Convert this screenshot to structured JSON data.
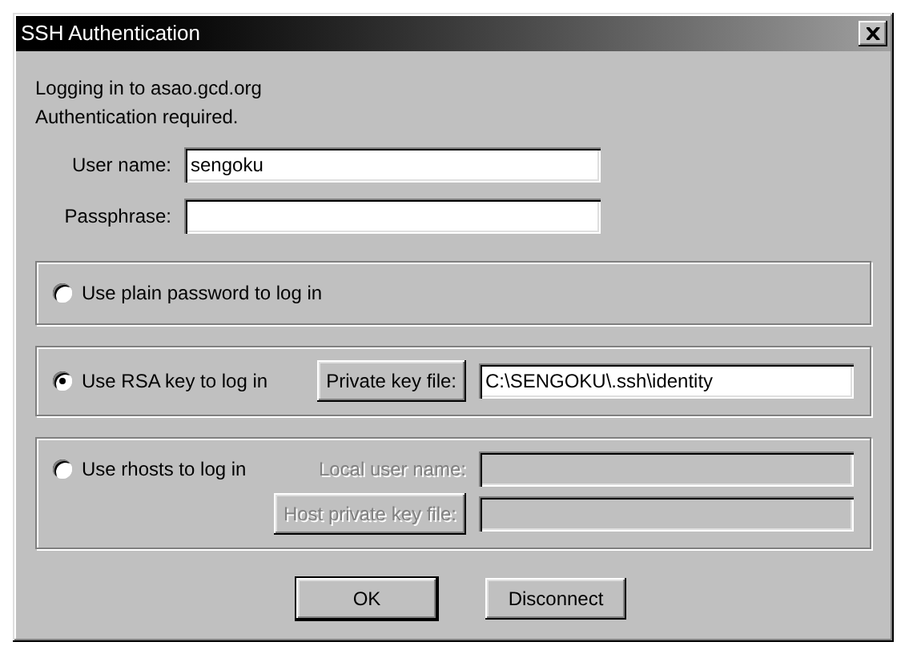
{
  "window": {
    "title": "SSH Authentication"
  },
  "messages": [
    "Logging in to asao.gcd.org",
    "Authentication required."
  ],
  "fields": [
    {
      "label": "User name:",
      "value": "sengoku"
    },
    {
      "label": "Passphrase:"
    }
  ],
  "methods": [
    {
      "label": "Use plain password to log in",
      "selected": false
    },
    {
      "label": "Use RSA key to log in",
      "selected": true,
      "controls": [
        {
          "kind": "file",
          "button": "Private key file:",
          "value": "C:\\SENGOKU\\.ssh\\identity",
          "disabled": false
        }
      ]
    },
    {
      "label": "Use rhosts to log in",
      "selected": false,
      "controls": [
        {
          "kind": "text",
          "label": "Local user name:",
          "disabled": true
        },
        {
          "kind": "file",
          "button": "Host private key file:",
          "disabled": true
        }
      ]
    }
  ],
  "buttons": [
    {
      "label": "OK",
      "default": true
    },
    {
      "label": "Disconnect",
      "default": false
    }
  ]
}
